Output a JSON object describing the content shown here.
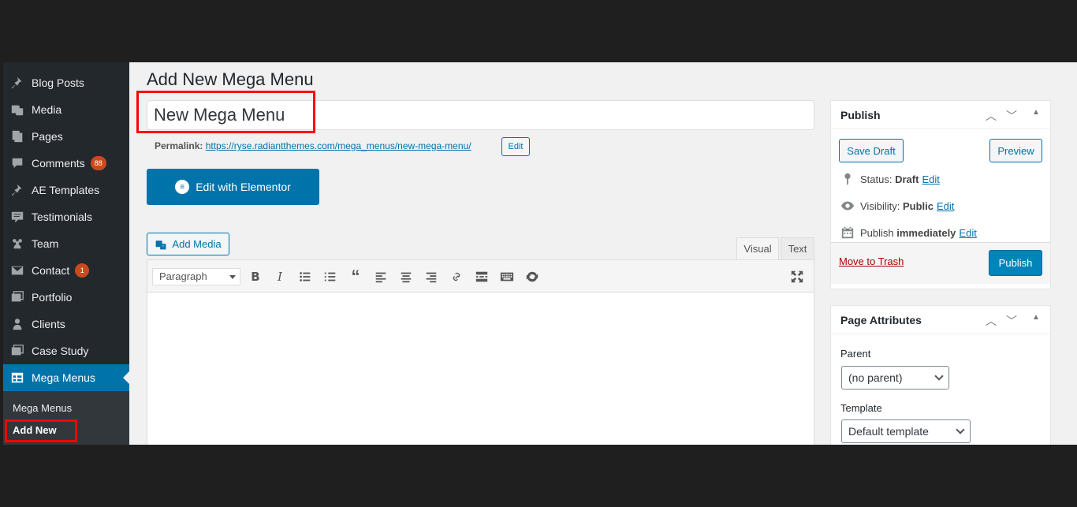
{
  "sidebar": {
    "items": [
      {
        "label": "Blog Posts",
        "icon": "pushpin-icon"
      },
      {
        "label": "Media",
        "icon": "media-icon"
      },
      {
        "label": "Pages",
        "icon": "pages-icon"
      },
      {
        "label": "Comments",
        "icon": "comment-icon",
        "badge": "88"
      },
      {
        "label": "AE Templates",
        "icon": "pushpin-icon"
      },
      {
        "label": "Testimonials",
        "icon": "testimonial-icon"
      },
      {
        "label": "Team",
        "icon": "groups-icon"
      },
      {
        "label": "Contact",
        "icon": "email-icon",
        "badge": "1"
      },
      {
        "label": "Portfolio",
        "icon": "portfolio-icon"
      },
      {
        "label": "Clients",
        "icon": "person-icon"
      },
      {
        "label": "Case Study",
        "icon": "portfolio-icon"
      },
      {
        "label": "Mega Menus",
        "icon": "table-icon",
        "active": true
      }
    ],
    "submenu": [
      {
        "label": "Mega Menus"
      },
      {
        "label": "Add New",
        "current": true
      }
    ]
  },
  "main": {
    "page_title": "Add New Mega Menu",
    "post_title_value": "New Mega Menu",
    "permalink_label": "Permalink:",
    "permalink_url": "https://ryse.radiantthemes.com/mega_menus/new-mega-menu/",
    "permalink_edit": "Edit",
    "elementor_button": "Edit with Elementor",
    "add_media": "Add Media",
    "tab_visual": "Visual",
    "tab_text": "Text",
    "format_select": "Paragraph"
  },
  "publish_box": {
    "title": "Publish",
    "save_draft": "Save Draft",
    "preview": "Preview",
    "status_label": "Status:",
    "status_value": "Draft",
    "visibility_label": "Visibility:",
    "visibility_value": "Public",
    "publish_label": "Publish",
    "publish_value": "immediately",
    "edit_link": "Edit",
    "move_to_trash": "Move to Trash",
    "publish_button": "Publish"
  },
  "page_attributes": {
    "title": "Page Attributes",
    "parent_label": "Parent",
    "parent_value": "(no parent)",
    "template_label": "Template",
    "template_value": "Default template"
  },
  "colors": {
    "sidebar_bg": "#23282d",
    "accent": "#0073aa",
    "highlight_box": "#ff0000"
  }
}
